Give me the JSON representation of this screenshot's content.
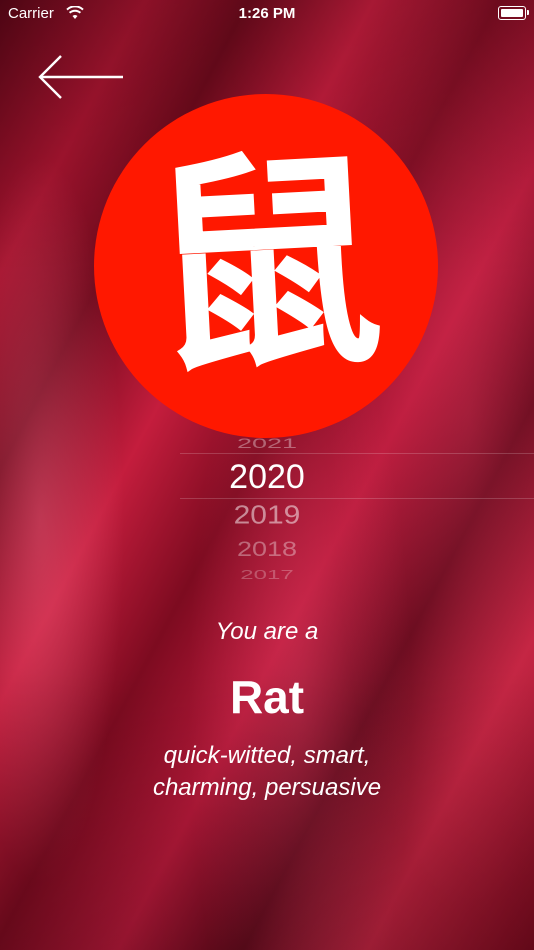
{
  "status_bar": {
    "carrier": "Carrier",
    "time": "1:26 PM",
    "wifi_icon": "wifi-icon",
    "battery_icon": "battery-icon"
  },
  "nav": {
    "back_icon": "arrow-left-icon"
  },
  "emblem": {
    "glyph": "鼠",
    "color": "#ff1800"
  },
  "year_picker": {
    "years": [
      "2021",
      "2020",
      "2019",
      "2018",
      "2017"
    ],
    "selected": "2020"
  },
  "result": {
    "intro": "You are a",
    "animal": "Rat",
    "traits_line1": "quick-witted, smart,",
    "traits_line2": "charming, persuasive"
  }
}
